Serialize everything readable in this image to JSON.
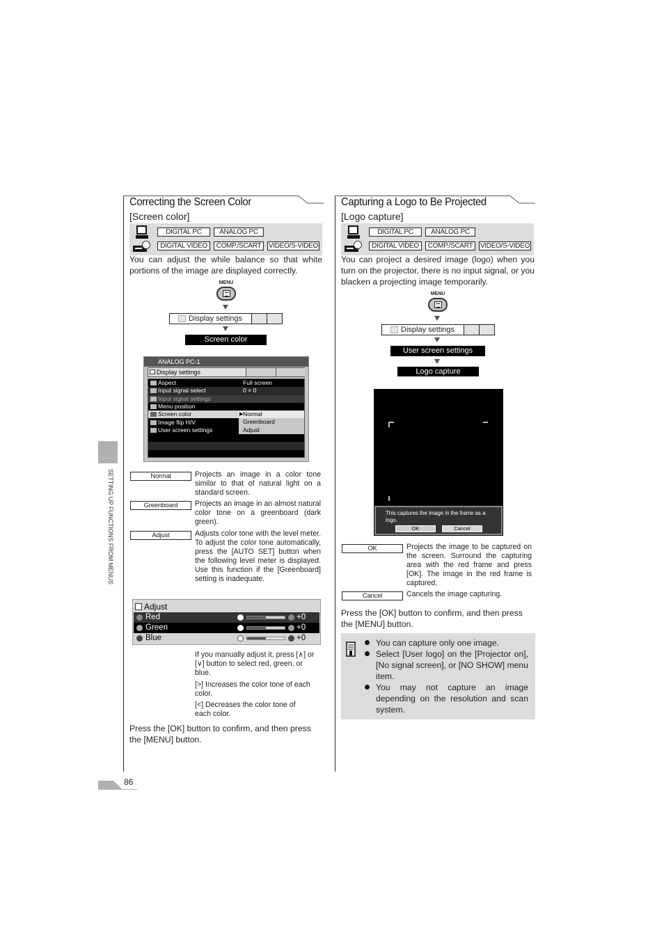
{
  "page": {
    "number": "86",
    "side_label": "SETTING UP FUNCTIONS FROM MENUS"
  },
  "left": {
    "title": "Correcting the Screen Color",
    "subtitle": "[Screen color]",
    "sources": {
      "row1": [
        "DIGITAL PC",
        "ANALOG PC"
      ],
      "row2": [
        "DIGITAL VIDEO",
        "COMP./SCART",
        "VIDEO/S-VIDEO"
      ]
    },
    "intro": "You can adjust the while balance so that white portions of the image are displayed correctly.",
    "menu_flow": {
      "menu_label": "MENU",
      "display_settings": "Display settings",
      "target": "Screen color"
    },
    "osd": {
      "title": "ANALOG PC-1",
      "header": "Display settings",
      "rows": [
        {
          "icon": "aspect-icon",
          "label": "Aspect",
          "value": "Full screen"
        },
        {
          "icon": "input-signal-select-icon",
          "label": "Input signal select",
          "value": "0 × 0"
        },
        {
          "icon": "input-signal-settings-icon",
          "label": "Input signal settings",
          "value": ""
        },
        {
          "icon": "menu-position-icon",
          "label": "Menu position",
          "value": ""
        },
        {
          "icon": "screen-color-icon",
          "label": "Screen color",
          "value": ""
        },
        {
          "icon": "image-flip-icon",
          "label": "Image flip H/V",
          "value": ""
        },
        {
          "icon": "user-screen-settings-icon",
          "label": "User screen settings",
          "value": ""
        }
      ],
      "dropdown": [
        "Normal",
        "Greenboard",
        "Adjust"
      ],
      "dropdown_selected": "Normal"
    },
    "options": [
      {
        "key": "Normal",
        "desc": "Projects an image in a color tone similar to that of natural light on a standard screen."
      },
      {
        "key": "Greenboard",
        "desc": "Projects an image in an almost natural color tone on a greenboard (dark green)."
      },
      {
        "key": "Adjust",
        "desc": "Adjusts color tone with the level meter. To adjust the color tone automatically, press the [AUTO SET] button when the following level meter is displayed. Use this function if the [Greenboard] setting is inadequate."
      }
    ],
    "adjust_panel": {
      "title": "Adjust",
      "rows": [
        {
          "label": "Red",
          "value": "+0",
          "level": 0.5
        },
        {
          "label": "Green",
          "value": "+0",
          "level": 0.5
        },
        {
          "label": "Blue",
          "value": "+0",
          "level": 0.5
        }
      ]
    },
    "adjust_notes": [
      "If you manually adjust it, press [∧] or [∨] button to select red, green, or blue.",
      "[>] Increases the color tone of each color.",
      "[<] Decreases the color tone of each color."
    ],
    "footer": "Press the [OK] button to confirm, and then press the [MENU] button."
  },
  "right": {
    "title": "Capturing a Logo to Be Projected",
    "subtitle": "[Logo capture]",
    "sources": {
      "row1": [
        "DIGITAL PC",
        "ANALOG PC"
      ],
      "row2": [
        "DIGITAL VIDEO",
        "COMP./SCART",
        "VIDEO/S-VIDEO"
      ]
    },
    "intro": "You can project a desired image (logo) when you turn on the projector, there is no input signal, or you blacken a projecting image temporarily.",
    "menu_flow": {
      "menu_label": "MENU",
      "display_settings": "Display settings",
      "step2": "User screen settings",
      "target": "Logo capture"
    },
    "capture_dialog": {
      "message": "This captures the image in the frame as a logo.",
      "ok": "OK",
      "cancel": "Cancel"
    },
    "options": [
      {
        "key": "OK",
        "desc": "Projects the image to be captured on the screen. Surround the capturing area with the red frame and press [OK]. The image in the red frame is captured."
      },
      {
        "key": "Cancel",
        "desc": "Cancels the image capturing."
      }
    ],
    "footer": "Press the [OK] button to confirm, and then press the [MENU] button.",
    "notes": [
      "You can capture only one image.",
      "Select [User logo] on the [Projector on], [No signal screen], or [NO SHOW] menu item.",
      "You may not capture an image depending on the resolution and scan system."
    ]
  }
}
